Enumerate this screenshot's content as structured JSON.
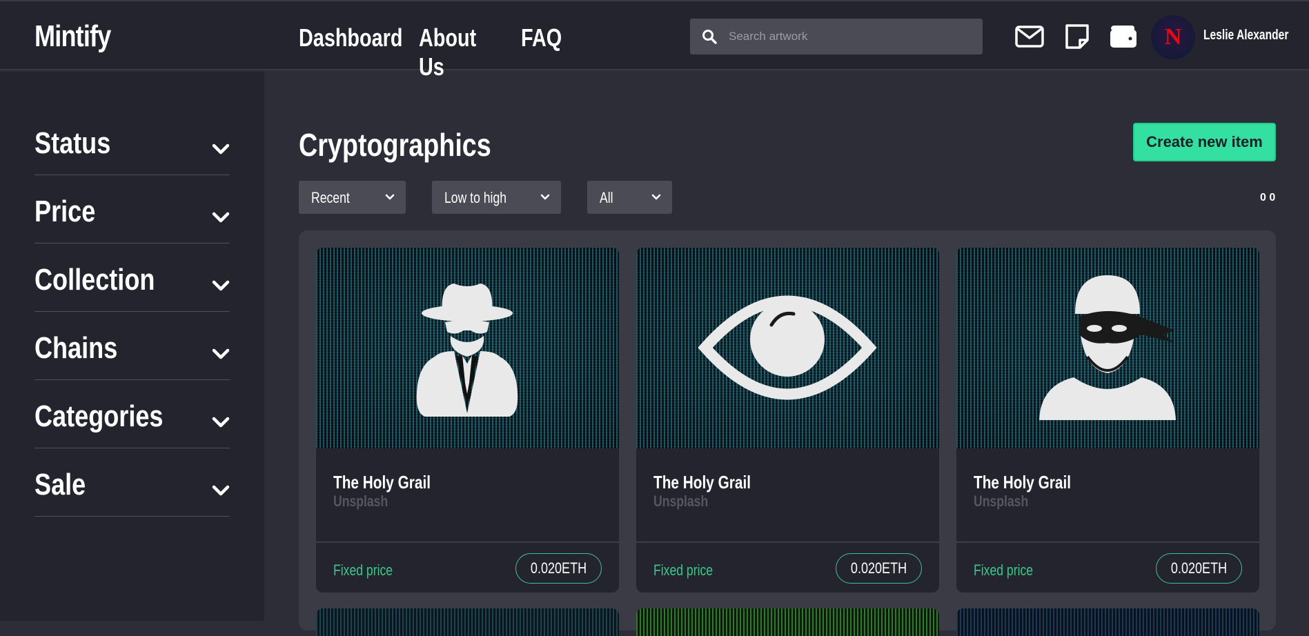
{
  "header": {
    "logo": "Mintify",
    "nav": [
      "Dashboard",
      "About Us",
      "FAQ"
    ],
    "search_placeholder": "Search artwork",
    "icons": [
      "mail-icon",
      "note-icon",
      "wallet-icon"
    ],
    "user_name": "Leslie Alexander",
    "avatar_letter": "N"
  },
  "sidebar": {
    "filters": [
      "Status",
      "Price",
      "Collection",
      "Chains",
      "Categories",
      "Sale"
    ]
  },
  "main": {
    "title": "Cryptographics",
    "create_button": "Create new item",
    "sort_options": [
      "Recent",
      "Low to high",
      "All"
    ],
    "count": "0 0",
    "cards": [
      {
        "name": "The Holy Grail",
        "source": "Unsplash",
        "price_type": "Fixed price",
        "price": "0.020ETH",
        "image": "spy-icon"
      },
      {
        "name": "The Holy Grail",
        "source": "Unsplash",
        "price_type": "Fixed price",
        "price": "0.020ETH",
        "image": "eye-icon"
      },
      {
        "name": "The Holy Grail",
        "source": "Unsplash",
        "price_type": "Fixed price",
        "price": "0.020ETH",
        "image": "thief-icon"
      }
    ]
  },
  "colors": {
    "accent": "#34e0a1",
    "price_green": "#3ec58c",
    "background": "#2c2d36",
    "panel": "#23242d"
  }
}
